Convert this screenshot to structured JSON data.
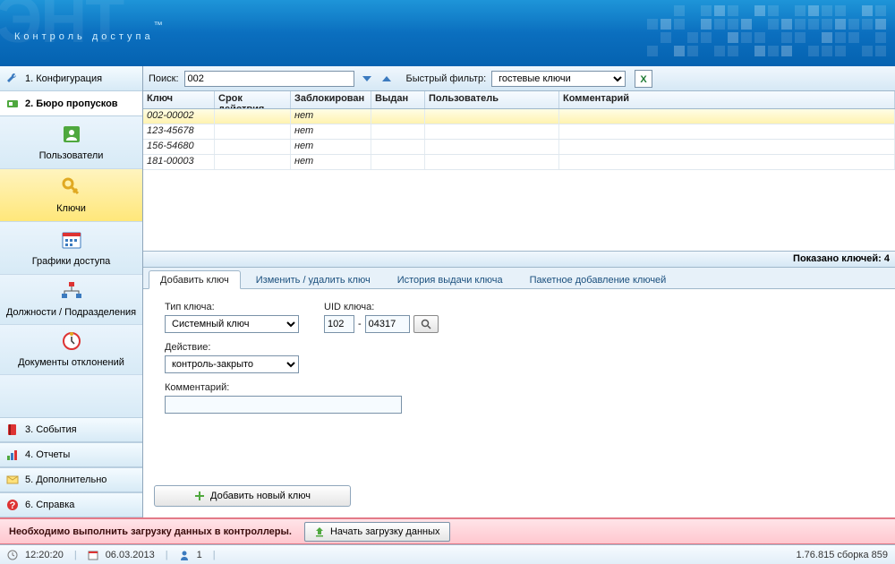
{
  "banner": {
    "title": "Контроль доступа",
    "bg_text": "ЭНТ"
  },
  "sidebar": {
    "items": [
      {
        "label": "1. Конфигурация"
      },
      {
        "label": "2. Бюро пропусков"
      },
      {
        "label": "3. События"
      },
      {
        "label": "4. Отчеты"
      },
      {
        "label": "5. Дополнительно"
      },
      {
        "label": "6. Справка"
      }
    ],
    "sub": [
      {
        "label": "Пользователи"
      },
      {
        "label": "Ключи"
      },
      {
        "label": "Графики доступа"
      },
      {
        "label": "Должности / Подразделения"
      },
      {
        "label": "Документы отклонений"
      }
    ]
  },
  "toolbar": {
    "search_label": "Поиск:",
    "search_value": "002",
    "filter_label": "Быстрый фильтр:",
    "filter_value": "гостевые ключи"
  },
  "grid": {
    "headers": [
      "Ключ",
      "Срок действия",
      "Заблокирован",
      "Выдан",
      "Пользователь",
      "Комментарий"
    ],
    "rows": [
      {
        "key": "002-00002",
        "blocked": "нет"
      },
      {
        "key": "123-45678",
        "blocked": "нет"
      },
      {
        "key": "156-54680",
        "blocked": "нет"
      },
      {
        "key": "181-00003",
        "blocked": "нет"
      }
    ],
    "footer": "Показано ключей: 4"
  },
  "tabs": [
    "Добавить ключ",
    "Изменить / удалить ключ",
    "История выдачи ключа",
    "Пакетное добавление ключей"
  ],
  "form": {
    "type_label": "Тип ключа:",
    "type_value": "Системный ключ",
    "uid_label": "UID ключа:",
    "uid_a": "102",
    "uid_sep": "-",
    "uid_b": "04317",
    "action_label": "Действие:",
    "action_value": "контроль-закрыто",
    "comment_label": "Комментарий:",
    "add_btn": "Добавить новый ключ"
  },
  "alert": {
    "text": "Необходимо выполнить загрузку данных в контроллеры.",
    "btn": "Начать загрузку данных"
  },
  "status": {
    "time": "12:20:20",
    "date": "06.03.2013",
    "users": "1",
    "version": "1.76.815 сборка 859"
  }
}
